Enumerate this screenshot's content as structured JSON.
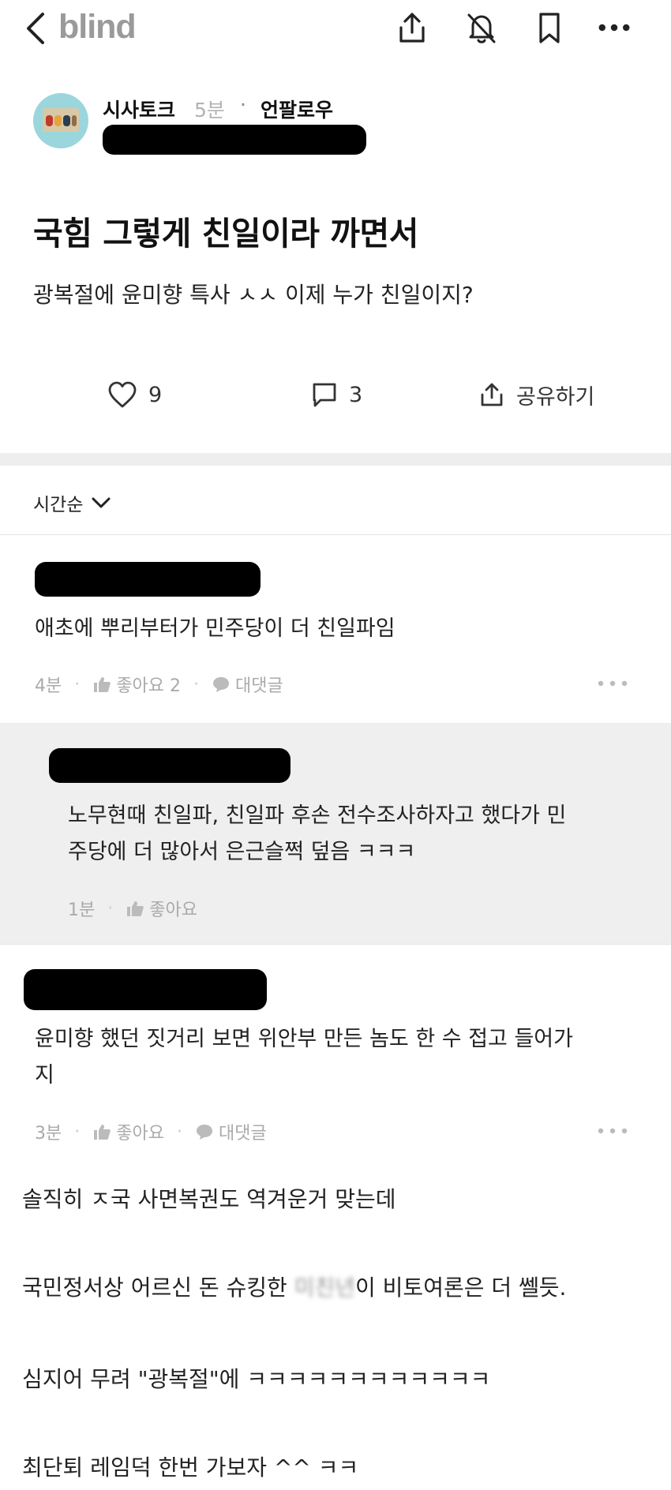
{
  "header": {
    "logo": "blind",
    "icons": [
      "back-icon",
      "share-icon",
      "bell-off-icon",
      "bookmark-icon",
      "more-icon"
    ]
  },
  "post": {
    "channel": "시사토크",
    "time": "5분",
    "separator": "·",
    "follow_label": "언팔로우",
    "title": "국힘 그렇게 친일이라 까면서",
    "body": "광복절에 윤미향 특사 ㅅㅅ  이제 누가 친일이지?",
    "likes": "9",
    "comments": "3",
    "share_label": "공유하기"
  },
  "sort": {
    "label": "시간순"
  },
  "comments": [
    {
      "text": "애초에 뿌리부터가 민주당이 더 친일파임",
      "time": "4분",
      "like_label": "좋아요 2",
      "reply_label": "대댓글"
    },
    {
      "text_line1": "노무현때 친일파, 친일파 후손 전수조사하자고 했다가 민",
      "text_line2": "주당에 더 많아서 은근슬쩍 덮음 ㅋㅋㅋ",
      "time": "1분",
      "like_label": "좋아요"
    },
    {
      "text_line1": "윤미향 했던 짓거리 보면 위안부 만든 놈도 한 수 접고 들어가",
      "text_line2": "지",
      "time": "3분",
      "like_label": "좋아요",
      "reply_label": "대댓글"
    }
  ],
  "extra_lines": {
    "line1": "솔직히 ㅈ국 사면복권도 역겨운거 맞는데",
    "line2_prefix": "국민정서상 어르신 돈 슈킹한 ",
    "line2_blurred": "미친년",
    "line2_suffix": "이 비토여론은 더 쎌듯.",
    "line3": "심지어 무려 \"광복절\"에 ㅋㅋㅋㅋㅋㅋㅋㅋㅋㅋㅋㅋ",
    "line4": "최단퇴 레임덕 한번 가보자 ^^ ㅋㅋ"
  }
}
